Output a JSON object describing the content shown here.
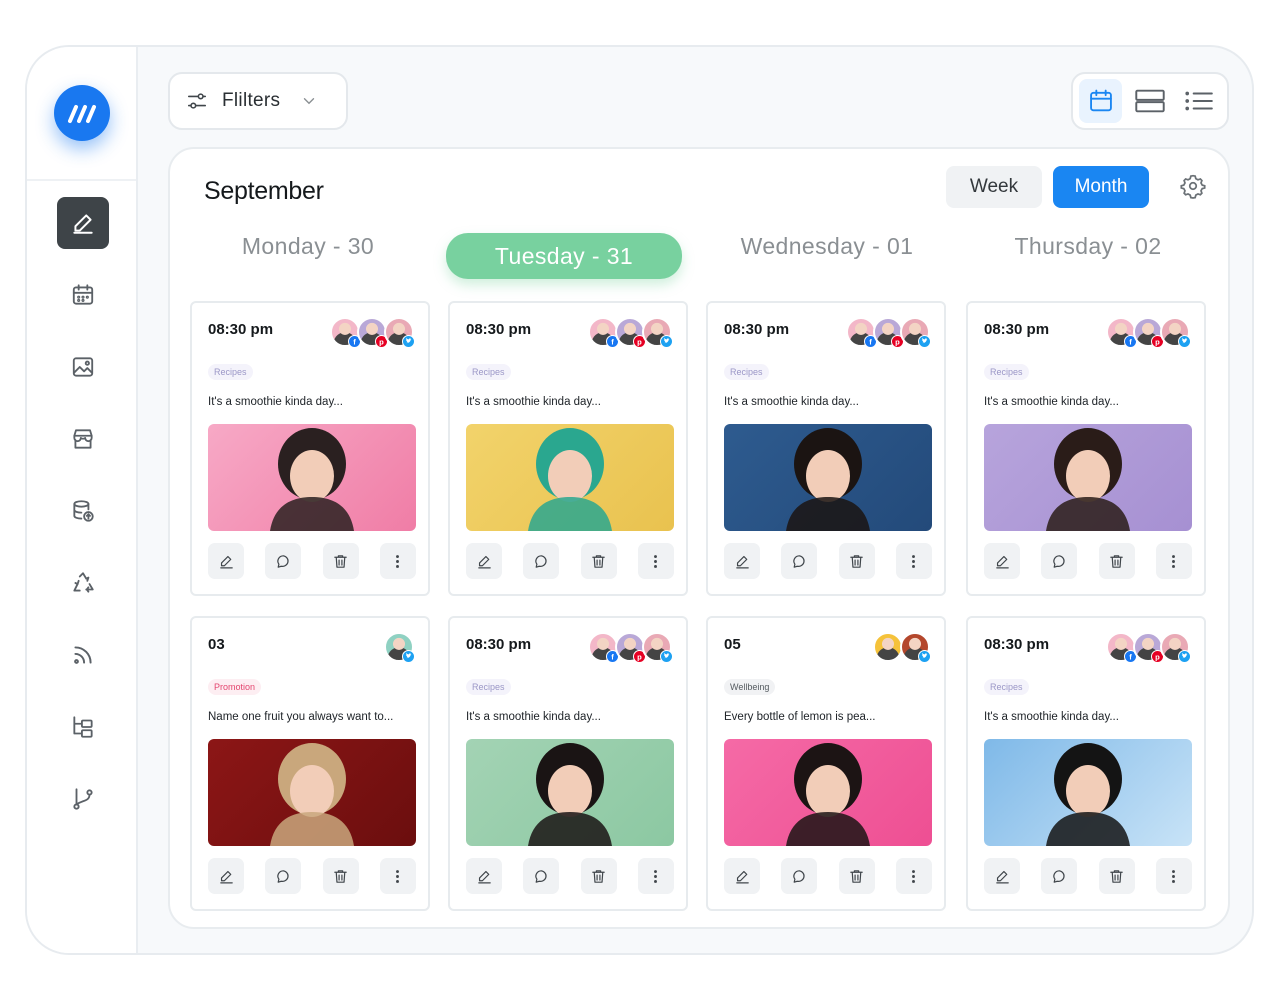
{
  "filters": {
    "label": "Flilters"
  },
  "calendar": {
    "month": "September",
    "view_week": "Week",
    "view_month": "Month",
    "days": [
      "Monday - 30",
      "Tuesday - 31",
      "Wednesday - 01",
      "Thursday - 02"
    ],
    "active_day_index": 1
  },
  "colors": {
    "accent_blue": "#1a86f2",
    "active_day_green": "#78d19f",
    "facebook": "#1877f2",
    "pinterest": "#e60023",
    "twitter": "#1da1f2"
  },
  "cards": [
    {
      "time": "08:30 pm",
      "tag": "Recipes",
      "tag_style": "recipes",
      "caption": "It's a smoothie kinda day...",
      "avatars": [
        {
          "bg": "#f3b7c8",
          "net": "facebook"
        },
        {
          "bg": "#b9a8d7",
          "net": "pinterest"
        },
        {
          "bg": "#e9a9b5",
          "net": "twitter"
        }
      ],
      "media_colors": [
        "#f7a9c6",
        "#f07da6"
      ],
      "figure": "#2a2020"
    },
    {
      "time": "08:30 pm",
      "tag": "Recipes",
      "tag_style": "recipes",
      "caption": "It's a smoothie kinda day...",
      "avatars": [
        {
          "bg": "#f3b7c8",
          "net": "facebook"
        },
        {
          "bg": "#b9a8d7",
          "net": "pinterest"
        },
        {
          "bg": "#e9a9b5",
          "net": "twitter"
        }
      ],
      "media_colors": [
        "#f2d36b",
        "#e9c24f"
      ],
      "figure": "#2aa78f"
    },
    {
      "time": "08:30 pm",
      "tag": "Recipes",
      "tag_style": "recipes",
      "caption": "It's a smoothie kinda day...",
      "avatars": [
        {
          "bg": "#f3b7c8",
          "net": "facebook"
        },
        {
          "bg": "#b9a8d7",
          "net": "pinterest"
        },
        {
          "bg": "#e9a9b5",
          "net": "twitter"
        }
      ],
      "media_colors": [
        "#2e5b8f",
        "#234a7a"
      ],
      "figure": "#1b1412"
    },
    {
      "time": "08:30 pm",
      "tag": "Recipes",
      "tag_style": "recipes",
      "caption": "It's a smoothie kinda day...",
      "avatars": [
        {
          "bg": "#f3b7c8",
          "net": "facebook"
        },
        {
          "bg": "#b9a8d7",
          "net": "pinterest"
        },
        {
          "bg": "#e9a9b5",
          "net": "twitter"
        }
      ],
      "media_colors": [
        "#b7a4dc",
        "#a690d2"
      ],
      "figure": "#2a1c18"
    },
    {
      "time": "03",
      "tag": "Promotion",
      "tag_style": "promotion",
      "caption": "Name one fruit you always want to...",
      "avatars": [
        {
          "bg": "#8fd1c2",
          "net": "twitter"
        }
      ],
      "media_colors": [
        "#8c1616",
        "#6b0e0e"
      ],
      "figure": "#c9a77c"
    },
    {
      "time": "08:30 pm",
      "tag": "Recipes",
      "tag_style": "recipes",
      "caption": "It's a smoothie kinda day...",
      "avatars": [
        {
          "bg": "#f3b7c8",
          "net": "facebook"
        },
        {
          "bg": "#b9a8d7",
          "net": "pinterest"
        },
        {
          "bg": "#e9a9b5",
          "net": "twitter"
        }
      ],
      "media_colors": [
        "#a3d3b4",
        "#8cc8a2"
      ],
      "figure": "#1a1414"
    },
    {
      "time": "05",
      "tag": "Wellbeing",
      "tag_style": "wellbeing",
      "caption": "Every bottle of lemon is pea...",
      "avatars": [
        {
          "bg": "#f5c23a",
          "net": "none"
        },
        {
          "bg": "#b4472c",
          "net": "twitter"
        }
      ],
      "media_colors": [
        "#f56aa6",
        "#ee4f93"
      ],
      "figure": "#1c1414"
    },
    {
      "time": "08:30 pm",
      "tag": "Recipes",
      "tag_style": "recipes",
      "caption": "It's a smoothie kinda day...",
      "avatars": [
        {
          "bg": "#f3b7c8",
          "net": "facebook"
        },
        {
          "bg": "#b9a8d7",
          "net": "pinterest"
        },
        {
          "bg": "#e9a9b5",
          "net": "twitter"
        }
      ],
      "media_colors": [
        "#7fb9e8",
        "#c8e3f7"
      ],
      "figure": "#141414"
    }
  ]
}
